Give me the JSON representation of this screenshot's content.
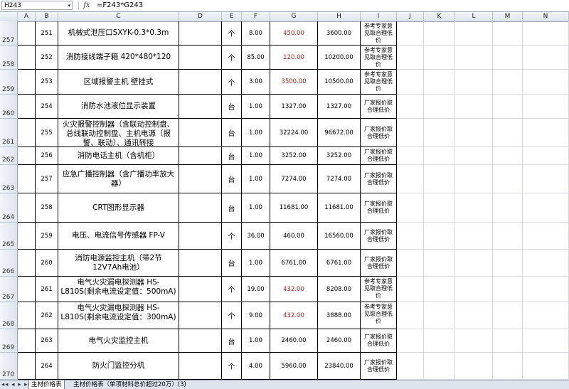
{
  "formula_bar": {
    "name_box": "H243",
    "dropdown_glyph": "▾",
    "fx_label": "fx",
    "formula": "=F243*G243"
  },
  "columns": [
    "A",
    "B",
    "C",
    "D",
    "E",
    "F",
    "G",
    "H",
    "I",
    "J",
    "K",
    "L",
    "M",
    "N"
  ],
  "rows": [
    {
      "row_num": "257",
      "no": "251",
      "name": "机械式泄压口SXYK-0.3*0.3m",
      "unit": "个",
      "qty": "8.00",
      "price": "450.00",
      "price_red": true,
      "total": "3600.00",
      "note": "参考专家意见取合理低价"
    },
    {
      "row_num": "258",
      "no": "252",
      "name": "消防接线端子箱 420*480*120",
      "unit": "个",
      "qty": "85.00",
      "price": "120.00",
      "price_red": true,
      "total": "10200.00",
      "note": "参考专家意见取合理低价"
    },
    {
      "row_num": "259",
      "no": "253",
      "name": "区域报警主机 壁挂式",
      "unit": "个",
      "qty": "3.00",
      "price": "3500.00",
      "price_red": true,
      "total": "10500.00",
      "note": "参考专家意见取合理低价"
    },
    {
      "row_num": "260",
      "no": "254",
      "name": "消防水池液位显示装置",
      "unit": "台",
      "qty": "1.00",
      "price": "1327.00",
      "price_red": false,
      "total": "1327.00",
      "note": "厂家报价取合理低价"
    },
    {
      "row_num": "261",
      "no": "255",
      "name": "火灾报警控制器（含联动控制盘、总线联动控制盘、主机电源（报警、联动）、通讯转接",
      "unit": "台",
      "qty": "1.00",
      "price": "32224.00",
      "price_red": false,
      "total": "96672.00",
      "note": "厂家报价取合理低价"
    },
    {
      "row_num": "262",
      "no": "256",
      "name": "消防电话主机（含机柜）",
      "unit": "台",
      "qty": "1.00",
      "price": "3252.00",
      "price_red": false,
      "total": "3252.00",
      "note": "厂家报价取合理低价"
    },
    {
      "row_num": "263",
      "no": "257",
      "name": "应急广播控制器（含广播功率放大器）",
      "unit": "台",
      "qty": "1.00",
      "price": "7274.00",
      "price_red": false,
      "total": "7274.00",
      "note": "厂家报价取合理低价"
    },
    {
      "row_num": "264",
      "no": "258",
      "name": "CRT图形显示器",
      "unit": "台",
      "qty": "1.00",
      "price": "11681.00",
      "price_red": false,
      "total": "11681.00",
      "note": "厂家报价取合理低价"
    },
    {
      "row_num": "265",
      "no": "259",
      "name": "电压、电流信号传感器 FP-V",
      "unit": "个",
      "qty": "36.00",
      "price": "460.00",
      "price_red": false,
      "total": "16560.00",
      "note": "厂家报价取合理低价"
    },
    {
      "row_num": "266",
      "no": "260",
      "name": "消防电源监控主机（带2节12V7Ah电池）",
      "unit": "台",
      "qty": "1.00",
      "price": "6761.00",
      "price_red": false,
      "total": "6761.00",
      "note": "厂家报价取合理低价"
    },
    {
      "row_num": "267",
      "no": "261",
      "name": "电气火灾漏电探测器 HS-L810S(剩余电流设定值：500mA)",
      "unit": "个",
      "qty": "19.00",
      "price": "432.00",
      "price_red": true,
      "total": "8208.00",
      "note": "参考专家意见取合理低价"
    },
    {
      "row_num": "268",
      "no": "262",
      "name": "电气火灾漏电探测器 HS-L810S(剩余电流设定值：300mA)",
      "unit": "个",
      "qty": "9.00",
      "price": "432.00",
      "price_red": true,
      "total": "3888.00",
      "note": "参考专家意见取合理低价"
    },
    {
      "row_num": "269",
      "no": "263",
      "name": "电气火灾监控主机",
      "unit": "台",
      "qty": "1.00",
      "price": "2460.00",
      "price_red": false,
      "total": "2460.00",
      "note": "厂家报价取合理低价"
    },
    {
      "row_num": "270",
      "no": "264",
      "name": "防火门监控分机",
      "unit": "个",
      "qty": "4.00",
      "price": "5960.00",
      "price_red": false,
      "total": "23840.00",
      "note": "厂家报价取合理低价"
    }
  ],
  "sheet_tabs": {
    "nav": "◂◂ ◂ ▸ ▸▸",
    "tabs": [
      "主材价格表",
      "主材价格表（单项材料总价超过20万）(3)"
    ]
  },
  "colors": {
    "red_price": "#b52020",
    "header_bg": "#dde4ee"
  }
}
